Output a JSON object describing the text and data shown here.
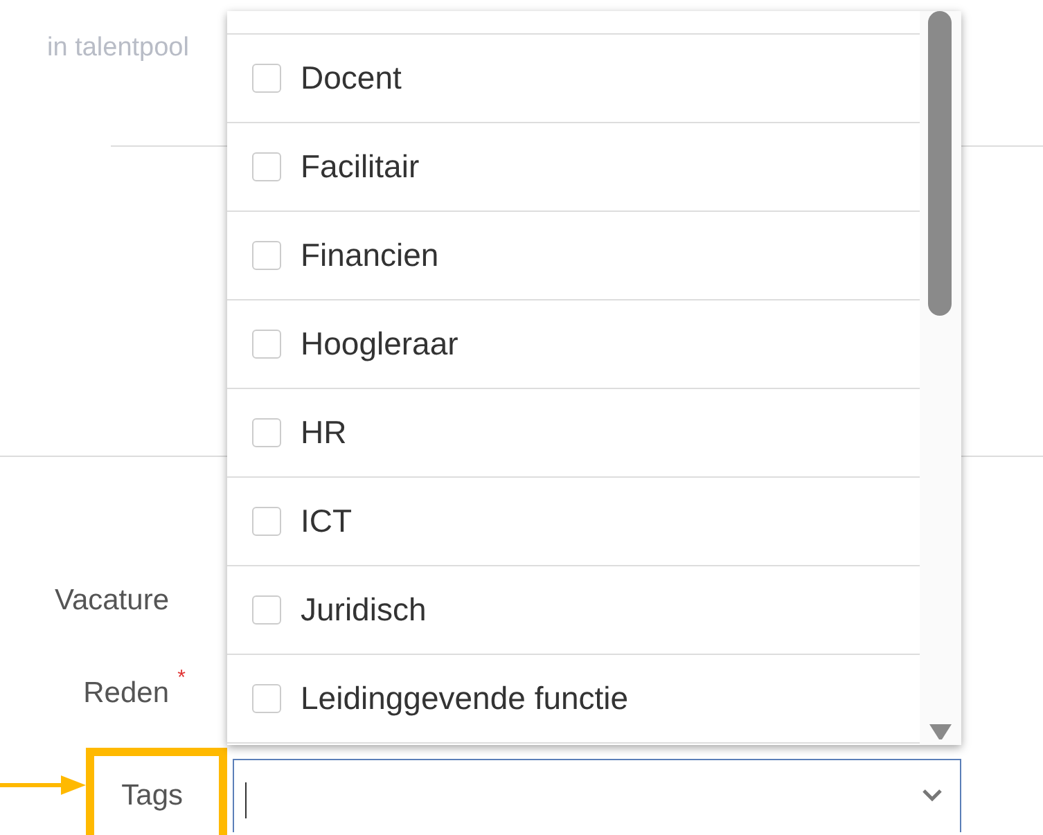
{
  "background_text": "in talentpool",
  "fields": [
    {
      "label": "Vacature",
      "highlighted": false
    },
    {
      "label": "Reden",
      "required_mark": "*",
      "highlighted": false
    },
    {
      "label": "Tags",
      "highlighted": true
    }
  ],
  "tags_input": {
    "focused": true
  },
  "dropdown": {
    "options": [
      {
        "label": "Docent",
        "checked": false
      },
      {
        "label": "Facilitair",
        "checked": false
      },
      {
        "label": "Financien",
        "checked": false
      },
      {
        "label": "Hoogleraar",
        "checked": false
      },
      {
        "label": "HR",
        "checked": false
      },
      {
        "label": "ICT",
        "checked": false
      },
      {
        "label": "Juridisch",
        "checked": false
      },
      {
        "label": "Leidinggevende functie",
        "checked": false
      }
    ]
  }
}
